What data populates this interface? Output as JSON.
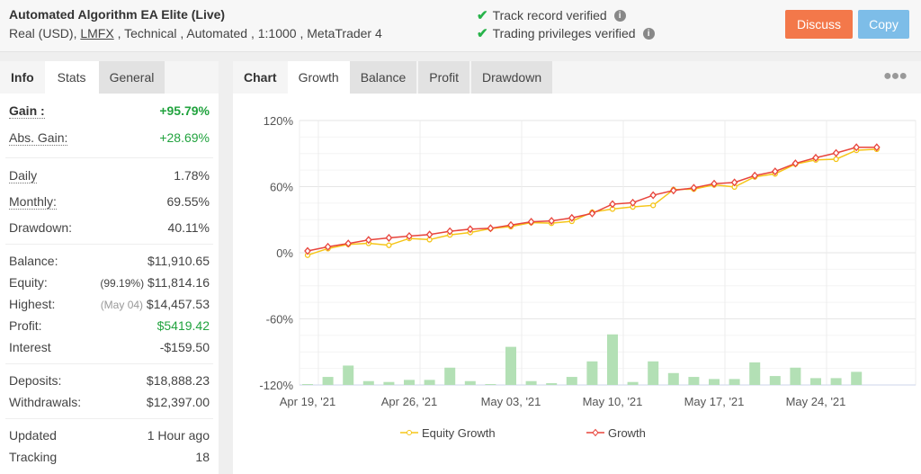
{
  "header": {
    "title": "Automated Algorithm EA Elite (Live)",
    "sub_prefix": "Real (USD), ",
    "broker": "LMFX",
    "sub_suffix": " , Technical , Automated , 1:1000 , MetaTrader 4",
    "verified": [
      "Track record verified",
      "Trading privileges verified"
    ],
    "discuss": "Discuss",
    "copy": "Copy",
    "colors": {
      "discuss": "#f3784a",
      "copy": "#7dbde8",
      "check": "#27b34a"
    }
  },
  "left_tabs": [
    "Info",
    "Stats",
    "General"
  ],
  "stats": {
    "gain": {
      "label": "Gain :",
      "value": "+95.79%"
    },
    "abs_gain": {
      "label": "Abs. Gain:",
      "value": "+28.69%"
    },
    "daily": {
      "label": "Daily",
      "value": "1.78%"
    },
    "monthly": {
      "label": "Monthly:",
      "value": "69.55%"
    },
    "drawdown": {
      "label": "Drawdown:",
      "value": "40.11%"
    },
    "balance": {
      "label": "Balance:",
      "value": "$11,910.65"
    },
    "equity": {
      "label": "Equity:",
      "note": "(99.19%)",
      "value": "$11,814.16"
    },
    "highest": {
      "label": "Highest:",
      "note": "(May 04)",
      "value": "$14,457.53"
    },
    "profit": {
      "label": "Profit:",
      "value": "$5419.42"
    },
    "interest": {
      "label": "Interest",
      "value": "-$159.50"
    },
    "deposits": {
      "label": "Deposits:",
      "value": "$18,888.23"
    },
    "withdrawals": {
      "label": "Withdrawals:",
      "value": "$12,397.00"
    },
    "updated": {
      "label": "Updated",
      "value": "1 Hour ago"
    },
    "tracking": {
      "label": "Tracking",
      "value": "18"
    }
  },
  "chart_tabs": [
    "Chart",
    "Growth",
    "Balance",
    "Profit",
    "Drawdown"
  ],
  "more_icon": "ellipsis-icon",
  "chart_data": {
    "type": "line",
    "ylim": [
      -120,
      120
    ],
    "yticks": [
      "120%",
      "60%",
      "0%",
      "-60%",
      "-120%"
    ],
    "ytick_values": [
      120,
      60,
      0,
      -60,
      -120
    ],
    "xtick_labels": [
      "Apr 19, '21",
      "Apr 26, '21",
      "May 03, '21",
      "May 10, '21",
      "May 17, '21",
      "May 24, '21"
    ],
    "xtick_index": [
      0,
      5,
      10,
      15,
      20,
      25
    ],
    "grid": true,
    "legend_placement": "bottom",
    "series": [
      {
        "name": "Equity Growth",
        "color": "#f5c518",
        "values": [
          -2.2,
          3.8,
          7.6,
          8.6,
          6.8,
          13,
          11.9,
          16.2,
          18.4,
          21.9,
          23.8,
          27.3,
          26.8,
          28.6,
          36.8,
          39.7,
          41.6,
          43,
          57.3,
          57.8,
          61.6,
          59.7,
          68.9,
          71.6,
          80.5,
          84.3,
          84.9,
          93,
          94
        ]
      },
      {
        "name": "Growth",
        "color": "#e8453c",
        "values": [
          1.6,
          5.4,
          8.4,
          11.6,
          13.5,
          15.1,
          16.5,
          19.5,
          21.4,
          22.2,
          25.1,
          28.1,
          28.9,
          31.6,
          35.7,
          44.1,
          45.4,
          52.2,
          56.5,
          58.9,
          62.7,
          63.8,
          70,
          73.8,
          81.1,
          86.2,
          90.5,
          95.7,
          95.7
        ]
      }
    ],
    "bars": {
      "color": "#b3e0b5",
      "values": [
        0.8,
        7.3,
        17.6,
        3.5,
        2.7,
        4.6,
        4.6,
        15.7,
        3.5,
        0.8,
        34.6,
        3.5,
        1.6,
        7.3,
        21.4,
        45.9,
        2.7,
        21.4,
        10.8,
        7.3,
        5.4,
        5.4,
        20.5,
        8.1,
        15.7,
        6.2,
        6.2,
        11.9
      ]
    }
  }
}
